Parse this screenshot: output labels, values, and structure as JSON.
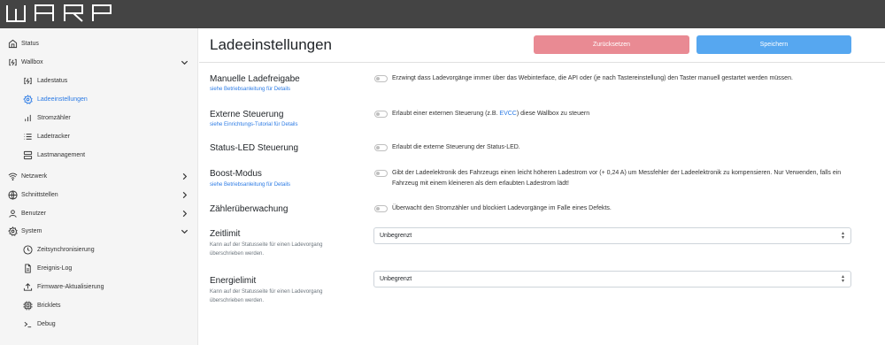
{
  "brand": {
    "logo_text": "WARP"
  },
  "sidebar": {
    "items": [
      {
        "label": "Status",
        "icon": "home-icon"
      },
      {
        "label": "Wallbox",
        "icon": "charger-icon"
      },
      {
        "label": "Ladestatus",
        "icon": "charger-icon"
      },
      {
        "label": "Ladeeinstellungen",
        "icon": "gear-icon"
      },
      {
        "label": "Stromzähler",
        "icon": "bar-chart-icon"
      },
      {
        "label": "Ladetracker",
        "icon": "list-icon"
      },
      {
        "label": "Lastmanagement",
        "icon": "server-icon"
      },
      {
        "label": "Netzwerk",
        "icon": "wifi-icon"
      },
      {
        "label": "Schnittstellen",
        "icon": "globe-icon"
      },
      {
        "label": "Benutzer",
        "icon": "user-icon"
      },
      {
        "label": "System",
        "icon": "gear-icon"
      },
      {
        "label": "Zeitsynchronisierung",
        "icon": "clock-icon"
      },
      {
        "label": "Ereignis-Log",
        "icon": "file-text-icon"
      },
      {
        "label": "Firmware-Aktualisierung",
        "icon": "upload-icon"
      },
      {
        "label": "Bricklets",
        "icon": "cpu-icon"
      },
      {
        "label": "Debug",
        "icon": "terminal-icon"
      }
    ]
  },
  "header": {
    "title": "Ladeeinstellungen",
    "reset_label": "Zurücksetzen",
    "save_label": "Speichern"
  },
  "settings": {
    "manual": {
      "title": "Manuelle Ladefreigabe",
      "sub": "siehe Betriebsanleitung für Details",
      "desc": "Erzwingt dass Ladevorgänge immer über das Webinterface, die API oder (je nach Tastereinstellung) den Taster manuell gestartet werden müssen.",
      "enabled": false
    },
    "external": {
      "title": "Externe Steuerung",
      "sub": "siehe Einrichtungs-Tutorial für Details",
      "desc_pre": "Erlaubt einer externen Steuerung (z.B. ",
      "desc_link": "EVCC",
      "desc_post": ") diese Wallbox zu steuern",
      "enabled": false
    },
    "led": {
      "title": "Status-LED Steuerung",
      "desc": "Erlaubt die externe Steuerung der Status-LED.",
      "enabled": false
    },
    "boost": {
      "title": "Boost-Modus",
      "sub": "siehe Betriebsanleitung für Details",
      "desc": "Gibt der Ladeelektronik des Fahrzeugs einen leicht höheren Ladestrom vor (+ 0,24 A) um Messfehler der Ladeelektronik zu kompensieren. Nur Verwenden, falls ein Fahrzeug mit einem kleineren als dem erlaubten Ladestrom lädt!",
      "enabled": false
    },
    "meter": {
      "title": "Zählerüberwachung",
      "desc": "Überwacht den Stromzähler und blockiert Ladevorgänge im Falle eines Defekts.",
      "enabled": false
    },
    "timelimit": {
      "title": "Zeitlimit",
      "help": "Kann auf der Statusseite für einen Ladevorgang überschrieben werden.",
      "value": "Unbegrenzt"
    },
    "energylimit": {
      "title": "Energielimit",
      "help": "Kann auf der Statusseite für einen Ladevorgang überschrieben werden.",
      "value": "Unbegrenzt"
    }
  },
  "colors": {
    "topbar": "#444444",
    "sidebar_bg": "#f5f5f5",
    "accent": "#2c7be5",
    "reset_button": "#e98a93",
    "save_button": "#56a7f0"
  }
}
